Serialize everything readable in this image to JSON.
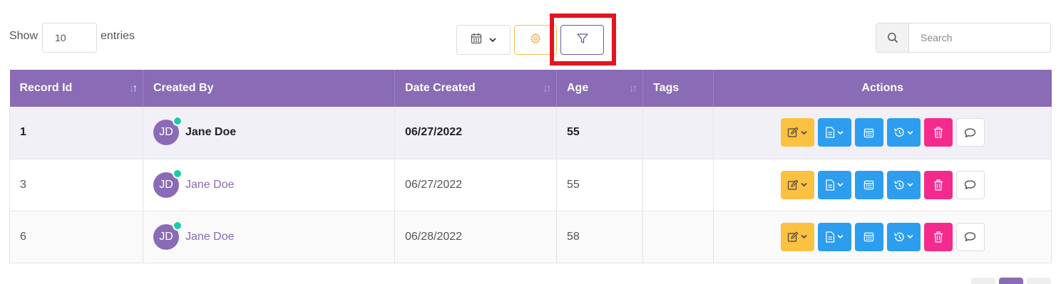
{
  "length_control": {
    "show_label": "Show",
    "value": "10",
    "entries_label": "entries"
  },
  "toolbar": {
    "date_button_icon": "calendar-icon",
    "settings_button_icon": "gear-icon",
    "filter_button_icon": "filter-icon"
  },
  "search": {
    "placeholder": "Search",
    "icon": "search-icon"
  },
  "table": {
    "columns": [
      {
        "label": "Record Id",
        "sortable": true
      },
      {
        "label": "Created By",
        "sortable": false
      },
      {
        "label": "Date Created",
        "sortable": true
      },
      {
        "label": "Age",
        "sortable": true
      },
      {
        "label": "Tags",
        "sortable": false
      },
      {
        "label": "Actions",
        "sortable": false
      }
    ],
    "rows": [
      {
        "record_id": "1",
        "initials": "JD",
        "created_by": "Jane Doe",
        "date_created": "06/27/2022",
        "age": "55",
        "tags": ""
      },
      {
        "record_id": "3",
        "initials": "JD",
        "created_by": "Jane Doe",
        "date_created": "06/27/2022",
        "age": "55",
        "tags": ""
      },
      {
        "record_id": "6",
        "initials": "JD",
        "created_by": "Jane Doe",
        "date_created": "06/28/2022",
        "age": "58",
        "tags": ""
      }
    ]
  },
  "colors": {
    "header": "#8a6bb5",
    "edit": "#fbc140",
    "primary": "#2d9df0",
    "delete": "#f42b8c",
    "online": "#1cc9a8",
    "highlight": "#e4151f"
  }
}
